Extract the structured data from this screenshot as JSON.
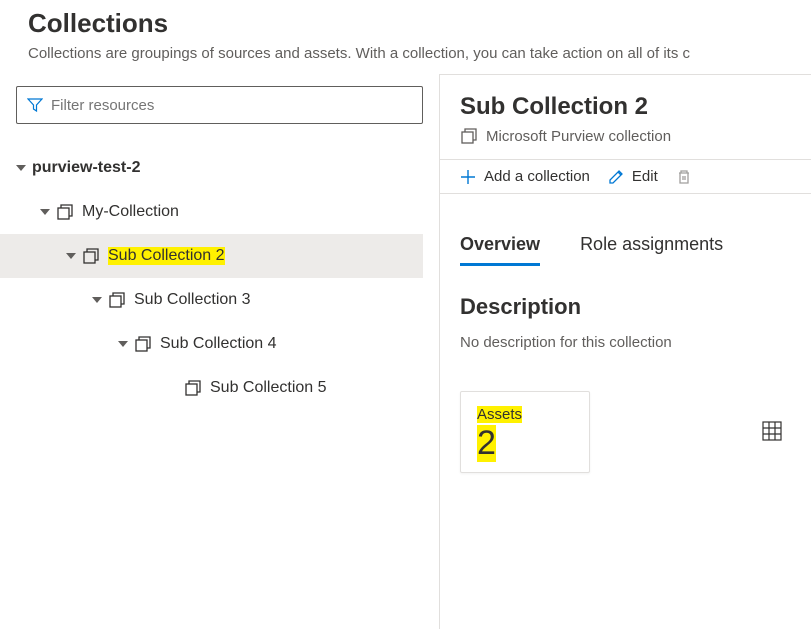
{
  "header": {
    "title": "Collections",
    "subtitle": "Collections are groupings of sources and assets. With a collection, you can take action on all of its c"
  },
  "filter": {
    "placeholder": "Filter resources"
  },
  "tree": {
    "root": "purview-test-2",
    "l1": "My-Collection",
    "l2": "Sub Collection 2",
    "l3": "Sub Collection 3",
    "l4": "Sub Collection 4",
    "l5": "Sub Collection 5"
  },
  "detail": {
    "title": "Sub Collection 2",
    "subtitle": "Microsoft Purview collection"
  },
  "toolbar": {
    "add": "Add a collection",
    "edit": "Edit"
  },
  "tabs": {
    "overview": "Overview",
    "roles": "Role assignments"
  },
  "description": {
    "title": "Description",
    "text": "No description for this collection"
  },
  "assets": {
    "label": "Assets",
    "value": "2"
  }
}
